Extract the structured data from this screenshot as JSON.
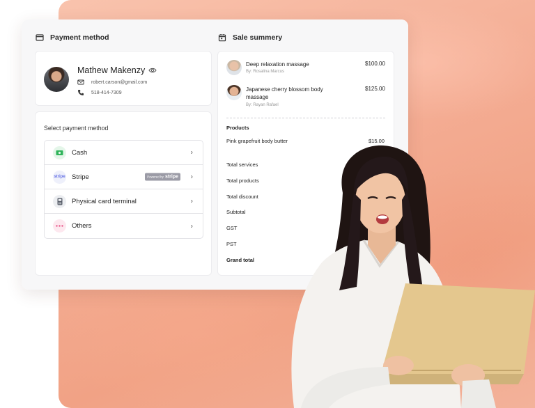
{
  "payment": {
    "title": "Payment method",
    "customer": {
      "name": "Mathew Makenzy",
      "email": "robert.carson@gmail.com",
      "phone": "518-414-7309"
    },
    "select_label": "Select payment method",
    "methods": [
      {
        "label": "Cash",
        "icon": "cash-icon",
        "color": "#2fb45a",
        "bg": "#e4f6e9"
      },
      {
        "label": "Stripe",
        "icon": "stripe-icon",
        "color": "#6772e5",
        "bg": "#eef0fb",
        "icon_text": "stripe",
        "badge_prefix": "Powered by",
        "badge_brand": "stripe"
      },
      {
        "label": "Physical card terminal",
        "icon": "card-terminal-icon",
        "color": "#555b66",
        "bg": "#eceef1"
      },
      {
        "label": "Others",
        "icon": "more-dots-icon",
        "color": "#e8578a",
        "bg": "#fde8ef"
      }
    ]
  },
  "summary": {
    "title": "Sale summery",
    "services": [
      {
        "name": "Deep relaxation massage",
        "by": "By: Rosalina Marcus",
        "price": "$100.00"
      },
      {
        "name": "Japanese cherry blossom body massage",
        "by": "By: Rayan Rafael",
        "price": "$125.00"
      }
    ],
    "products_heading": "Products",
    "products": [
      {
        "name": "Pink grapefruit body butter",
        "price": "$15.00"
      }
    ],
    "totals": [
      "Total services",
      "Total products",
      "Total discount",
      "Subtotal",
      "GST",
      "PST"
    ],
    "grand_total": "Grand total"
  },
  "colors": {
    "background": "#f4ad94",
    "card": "#ffffff",
    "accent_green": "#2fb45a"
  }
}
